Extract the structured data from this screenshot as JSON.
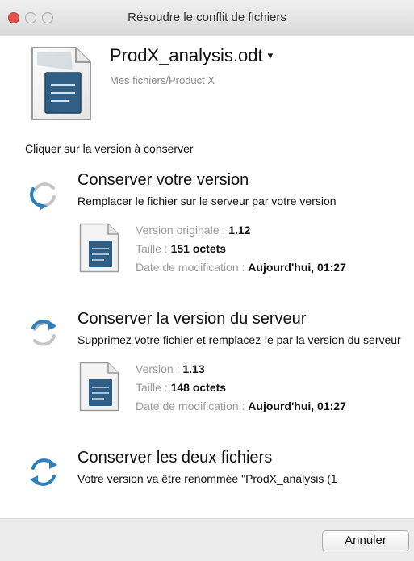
{
  "window": {
    "title": "Résoudre le conflit de fichiers"
  },
  "file": {
    "name": "ProdX_analysis.odt",
    "path": "Mes fichiers/Product X",
    "caret": "▾"
  },
  "instruction": "Cliquer sur la version à conserver",
  "options": [
    {
      "title": "Conserver votre version",
      "description": "Remplacer le fichier sur le serveur par votre version",
      "details": {
        "version_label": "Version originale :",
        "version_value": "1.12",
        "size_label": "Taille :",
        "size_value": "151 octets",
        "date_label": "Date de modification :",
        "date_value": "Aujourd'hui, 01:27"
      }
    },
    {
      "title": "Conserver la version du serveur",
      "description": "Supprimez votre fichier et remplacez-le par la version du serveur",
      "details": {
        "version_label": "Version :",
        "version_value": "1.13",
        "size_label": "Taille :",
        "size_value": "148 octets",
        "date_label": "Date de modification :",
        "date_value": "Aujourd'hui, 01:27"
      }
    },
    {
      "title": "Conserver les deux fichiers",
      "description": "Votre version va être renommée \"ProdX_analysis (1"
    }
  ],
  "buttons": {
    "cancel": "Annuler"
  },
  "icons": {
    "document": "odt-document-icon",
    "refresh": "refresh-arrows-icon"
  },
  "colors": {
    "refresh_active": "#2a7fc1",
    "refresh_inactive": "#b9b9b9"
  }
}
